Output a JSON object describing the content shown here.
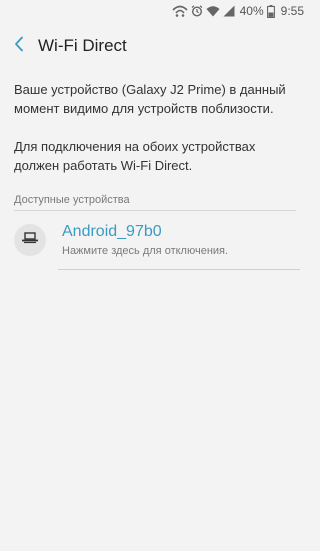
{
  "status_bar": {
    "battery_percent": "40%",
    "time": "9:55",
    "icons": [
      "wifi-direct-icon",
      "alarm-icon",
      "wifi-icon",
      "signal-icon",
      "battery-icon"
    ]
  },
  "app_bar": {
    "title": "Wi-Fi Direct",
    "back_icon": "chevron-left-icon"
  },
  "info": {
    "visibility_text": "Ваше устройство (Galaxy J2 Prime) в данный момент видимо для устройств поблизости.",
    "requirement_text": "Для подключения на обоих устройствах должен работать Wi-Fi Direct."
  },
  "devices_section": {
    "label": "Доступные устройства",
    "items": [
      {
        "name": "Android_97b0",
        "status": "Нажмите здесь для отключения.",
        "icon": "tv-device-icon"
      }
    ]
  },
  "colors": {
    "background": "#f3f3f3",
    "accent": "#3a9cc3",
    "secondary_text": "#7a7a7a"
  }
}
